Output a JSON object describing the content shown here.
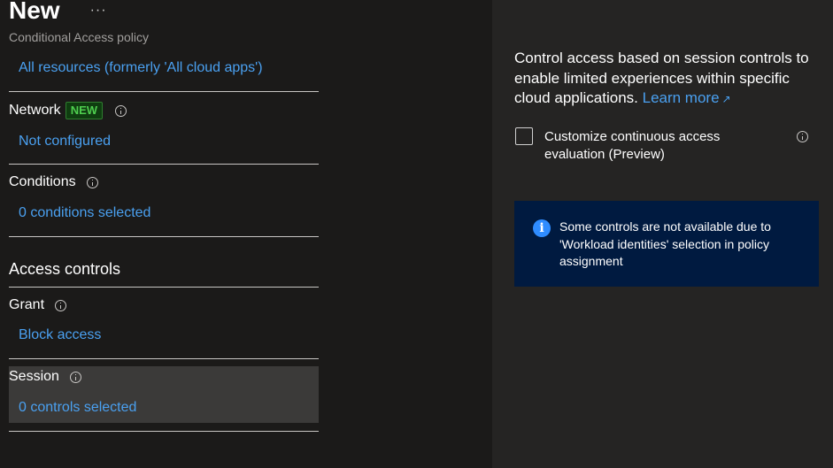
{
  "header": {
    "title": "New",
    "more_label": "···",
    "subtitle": "Conditional Access policy"
  },
  "assignments": {
    "resources_link": "All resources (formerly 'All cloud apps')",
    "network": {
      "label": "Network",
      "badge": "NEW",
      "value": "Not configured"
    },
    "conditions": {
      "label": "Conditions",
      "value": "0 conditions selected"
    }
  },
  "access_controls": {
    "heading": "Access controls",
    "grant": {
      "label": "Grant",
      "value": "Block access"
    },
    "session": {
      "label": "Session",
      "value": "0 controls selected",
      "selected": true
    }
  },
  "session_panel": {
    "description": "Control access based on session controls to enable limited experiences within specific cloud applications.",
    "learn_more": "Learn more",
    "checkbox_label": "Customize continuous access evaluation (Preview)",
    "checkbox_checked": false,
    "notice": "Some controls are not available due to 'Workload identities' selection in policy assignment"
  },
  "colors": {
    "link": "#4aa0f0",
    "background": "#1b1a19",
    "panel_background": "#252423",
    "selected_row": "#3b3a39",
    "notice_background": "#001a40",
    "badge_text": "#4fce4f"
  }
}
